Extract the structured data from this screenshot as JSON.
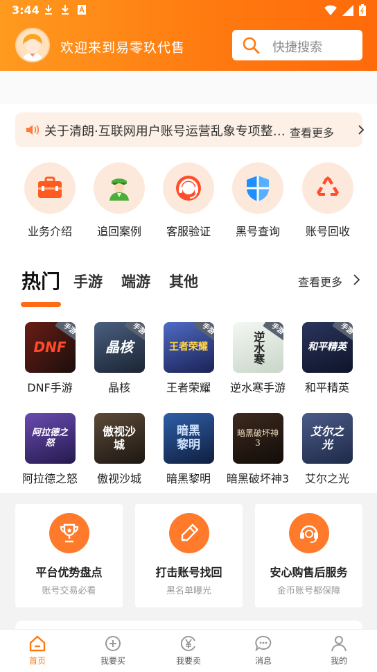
{
  "status_bar": {
    "time": "3:44"
  },
  "header": {
    "welcome": "欢迎来到易零玖代售",
    "search_placeholder": "快捷搜索",
    "accent": "#ff7a10"
  },
  "notice": {
    "text": "关于清朗·互联网用户账号运营乱象专项整治行动的公告",
    "more": "查看更多"
  },
  "quick_links": [
    {
      "label": "业务介绍",
      "icon": "briefcase-icon"
    },
    {
      "label": "追回案例",
      "icon": "officer-icon"
    },
    {
      "label": "客服验证",
      "icon": "headset-icon"
    },
    {
      "label": "黑号查询",
      "icon": "shield-icon"
    },
    {
      "label": "账号回收",
      "icon": "recycle-icon"
    }
  ],
  "tabs": {
    "items": [
      "热门",
      "手游",
      "端游",
      "其他"
    ],
    "active": "热门",
    "more": "查看更多"
  },
  "games": [
    {
      "label": "DNF手游",
      "art": "DNF",
      "tag": "手游",
      "color": "#3a1e1a"
    },
    {
      "label": "晶核",
      "art": "晶核",
      "tag": "手游",
      "color": "#2d3d55"
    },
    {
      "label": "王者荣耀",
      "art": "王者荣耀",
      "tag": "手游",
      "color": "#2e3d7a"
    },
    {
      "label": "逆水寒手游",
      "art": "逆水寒",
      "tag": "手游",
      "color": "#e8eee8"
    },
    {
      "label": "和平精英",
      "art": "和平精英",
      "tag": "手游",
      "color": "#1b2440"
    },
    {
      "label": "阿拉德之怒",
      "art": "阿拉德之怒",
      "tag": "",
      "color": "#3b2a6e"
    },
    {
      "label": "傲视沙城",
      "art": "傲视沙城",
      "tag": "",
      "color": "#3a2e24"
    },
    {
      "label": "暗黑黎明",
      "art": "暗黑黎明",
      "tag": "",
      "color": "#1f3d6e"
    },
    {
      "label": "暗黑破坏神3",
      "art": "暗黑破坏神3",
      "tag": "",
      "color": "#2a1c16"
    },
    {
      "label": "艾尔之光",
      "art": "艾尔之光",
      "tag": "",
      "color": "#2f3d5e"
    }
  ],
  "features": [
    {
      "title": "平台优势盘点",
      "sub": "账号交易必看",
      "icon": "trophy-icon"
    },
    {
      "title": "打击账号找回",
      "sub": "黑名单曝光",
      "icon": "pencil-icon"
    },
    {
      "title": "安心购售后服务",
      "sub": "金币账号都保障",
      "icon": "service-icon"
    }
  ],
  "bottom_nav": [
    {
      "label": "首页",
      "icon": "home-icon",
      "active": true
    },
    {
      "label": "我要买",
      "icon": "plus-circle-icon",
      "active": false
    },
    {
      "label": "我要卖",
      "icon": "yen-icon",
      "active": false
    },
    {
      "label": "消息",
      "icon": "message-icon",
      "active": false
    },
    {
      "label": "我的",
      "icon": "user-icon",
      "active": false
    }
  ]
}
